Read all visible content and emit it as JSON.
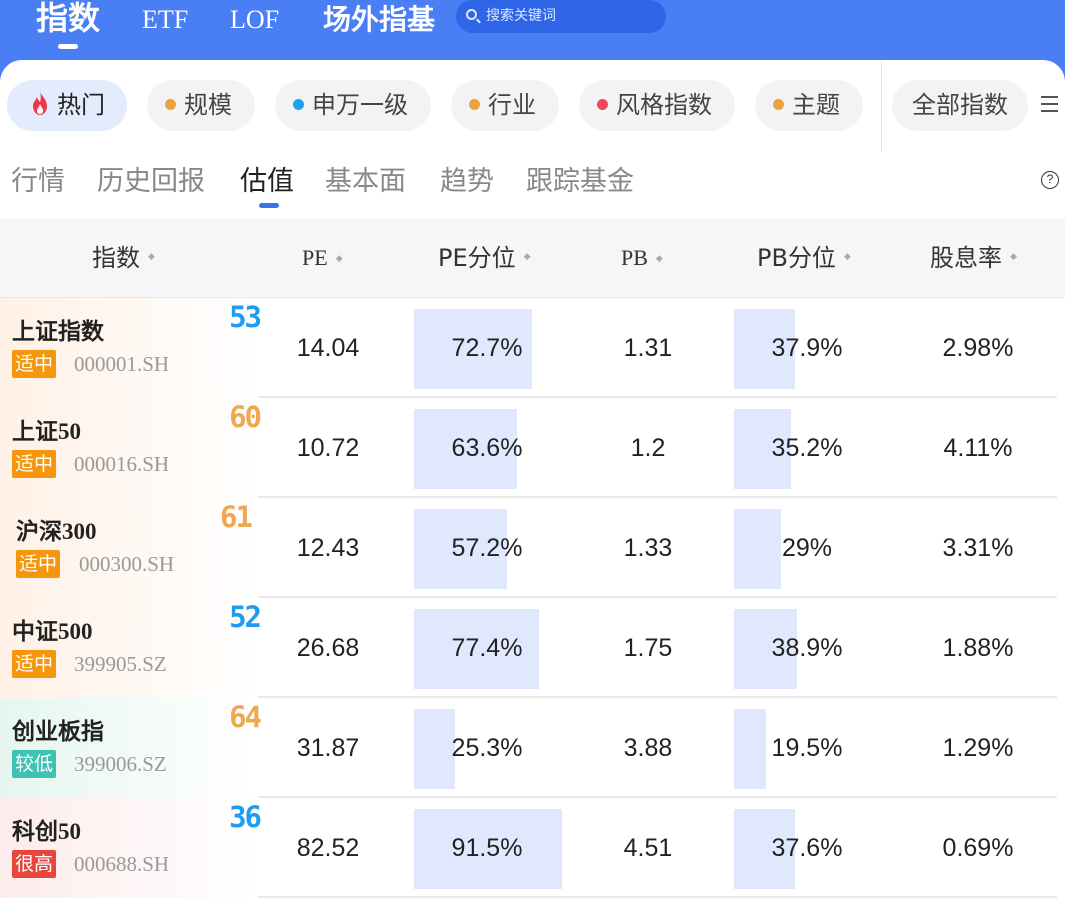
{
  "topnav": {
    "items": [
      "指数",
      "ETF",
      "LOF",
      "场外指基"
    ],
    "search_placeholder": "搜索关键词"
  },
  "chips": [
    {
      "label": "热门",
      "icon": "flame-icon",
      "active": true
    },
    {
      "label": "规模",
      "dot": "#f0a23a"
    },
    {
      "label": "申万一级",
      "dot": "#1aa3f0"
    },
    {
      "label": "行业",
      "dot": "#f0a23a"
    },
    {
      "label": "风格指数",
      "dot": "#f0495a"
    },
    {
      "label": "主题",
      "dot": "#f0a23a"
    },
    {
      "label": "全部指数"
    }
  ],
  "subtabs": [
    "行情",
    "历史回报",
    "估值",
    "基本面",
    "趋势",
    "跟踪基金"
  ],
  "active_subtab": "估值",
  "table": {
    "headers": [
      "指数",
      "PE",
      "PE分位",
      "PB",
      "PB分位",
      "股息率"
    ],
    "rows": [
      {
        "name": "上证指数",
        "badge": "适中",
        "code": "000001.SH",
        "score": "53",
        "pe": "14.04",
        "pe_pct": "72.7%",
        "pe_frac": 0.727,
        "pb": "1.31",
        "pb_pct": "37.9%",
        "pb_frac": 0.379,
        "yield": "2.98%"
      },
      {
        "name": "上证50",
        "badge": "适中",
        "code": "000016.SH",
        "score": "60",
        "pe": "10.72",
        "pe_pct": "63.6%",
        "pe_frac": 0.636,
        "pb": "1.2",
        "pb_pct": "35.2%",
        "pb_frac": 0.352,
        "yield": "4.11%"
      },
      {
        "name": "沪深300",
        "badge": "适中",
        "code": "000300.SH",
        "score": "61",
        "pe": "12.43",
        "pe_pct": "57.2%",
        "pe_frac": 0.572,
        "pb": "1.33",
        "pb_pct": "29%",
        "pb_frac": 0.29,
        "yield": "3.31%"
      },
      {
        "name": "中证500",
        "badge": "适中",
        "code": "399905.SZ",
        "score": "52",
        "pe": "26.68",
        "pe_pct": "77.4%",
        "pe_frac": 0.774,
        "pb": "1.75",
        "pb_pct": "38.9%",
        "pb_frac": 0.389,
        "yield": "1.88%"
      },
      {
        "name": "创业板指",
        "badge": "较低",
        "code": "399006.SZ",
        "score": "64",
        "pe": "31.87",
        "pe_pct": "25.3%",
        "pe_frac": 0.253,
        "pb": "3.88",
        "pb_pct": "19.5%",
        "pb_frac": 0.195,
        "yield": "1.29%"
      },
      {
        "name": "科创50",
        "badge": "很高",
        "code": "000688.SH",
        "score": "36",
        "pe": "82.52",
        "pe_pct": "91.5%",
        "pe_frac": 0.915,
        "pb": "4.51",
        "pb_pct": "37.6%",
        "pb_frac": 0.376,
        "yield": "0.69%"
      }
    ]
  },
  "colors": {
    "brand_blue": "#4a7ef5",
    "badge_moderate": "#f5960c",
    "badge_low": "#3cc3b4",
    "badge_high": "#e8463c",
    "score_blue": "#1e9cf0",
    "score_orange": "#f0a850",
    "bar_fill": "#dfe8fc"
  }
}
